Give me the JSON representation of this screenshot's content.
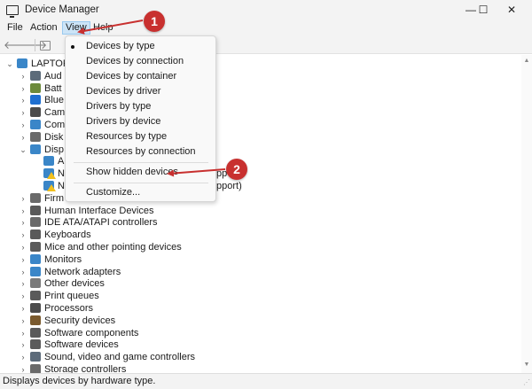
{
  "window": {
    "title": "Device Manager",
    "controls": {
      "minimize": "—",
      "maximize": "☐",
      "close": "✕"
    }
  },
  "menubar": [
    "File",
    "Action",
    "View",
    "Help"
  ],
  "toolbar": {
    "icons": [
      "back-arrow-icon",
      "forward-arrow-icon",
      "properties-icon"
    ]
  },
  "tree": {
    "root": "LAPTOP",
    "categories": [
      {
        "label": "Audio inputs and outputs",
        "visible": "Aud",
        "icon": "speaker-icon",
        "color": "#5c6b7a"
      },
      {
        "label": "Batteries",
        "visible": "Batt",
        "icon": "battery-icon",
        "color": "#6c8a3b"
      },
      {
        "label": "Bluetooth",
        "visible": "Blue",
        "icon": "bluetooth-icon",
        "color": "#1e6fd0"
      },
      {
        "label": "Cameras",
        "visible": "Cam",
        "icon": "camera-icon",
        "color": "#4b4b4b"
      },
      {
        "label": "Computer",
        "visible": "Com",
        "icon": "computer-icon",
        "color": "#3a86c8"
      },
      {
        "label": "Disk drives",
        "visible": "Disk",
        "icon": "disk-icon",
        "color": "#6a6a6a"
      },
      {
        "label": "Display adapters",
        "visible": "Disp",
        "icon": "display-icon",
        "color": "#3a86c8",
        "expanded": true
      }
    ],
    "display_children": [
      {
        "visible": "A",
        "icon": "monitor-icon",
        "warning": false
      },
      {
        "visible": "N",
        "icon": "monitor-warning-icon",
        "warning": true,
        "trailing": "pp"
      },
      {
        "visible": "N",
        "icon": "monitor-warning-icon",
        "warning": true,
        "trailing": "pport)"
      }
    ],
    "more_categories": [
      {
        "label": "Firmware",
        "visible": "Firm",
        "icon": "firmware-icon",
        "color": "#6a6a6a"
      },
      {
        "label": "Human Interface Devices",
        "icon": "hid-icon",
        "color": "#5a5a5a"
      },
      {
        "label": "IDE ATA/ATAPI controllers",
        "icon": "ide-icon",
        "color": "#6a6a6a"
      },
      {
        "label": "Keyboards",
        "icon": "keyboard-icon",
        "color": "#5a5a5a"
      },
      {
        "label": "Mice and other pointing devices",
        "icon": "mouse-icon",
        "color": "#5a5a5a"
      },
      {
        "label": "Monitors",
        "icon": "monitor-icon",
        "color": "#3a86c8"
      },
      {
        "label": "Network adapters",
        "icon": "network-icon",
        "color": "#3a86c8"
      },
      {
        "label": "Other devices",
        "icon": "other-devices-icon",
        "color": "#7a7a7a"
      },
      {
        "label": "Print queues",
        "icon": "printer-icon",
        "color": "#5a5a5a"
      },
      {
        "label": "Processors",
        "icon": "processor-icon",
        "color": "#4b4b4b"
      },
      {
        "label": "Security devices",
        "icon": "security-icon",
        "color": "#7a5a2e"
      },
      {
        "label": "Software components",
        "icon": "software-component-icon",
        "color": "#5a5a5a"
      },
      {
        "label": "Software devices",
        "icon": "software-device-icon",
        "color": "#5a5a5a"
      },
      {
        "label": "Sound, video and game controllers",
        "icon": "sound-icon",
        "color": "#5c6b7a"
      },
      {
        "label": "Storage controllers",
        "icon": "storage-icon",
        "color": "#6a6a6a"
      }
    ]
  },
  "view_menu": {
    "items": [
      {
        "label": "Devices by type",
        "checked": true
      },
      {
        "label": "Devices by connection",
        "checked": false
      },
      {
        "label": "Devices by container",
        "checked": false
      },
      {
        "label": "Devices by driver",
        "checked": false
      },
      {
        "label": "Drivers by type",
        "checked": false
      },
      {
        "label": "Drivers by device",
        "checked": false
      },
      {
        "label": "Resources by type",
        "checked": false
      },
      {
        "label": "Resources by connection",
        "checked": false
      }
    ],
    "show_hidden": "Show hidden devices",
    "customize": "Customize..."
  },
  "statusbar": {
    "text": "Displays devices by hardware type."
  },
  "annotations": [
    {
      "number": "1",
      "color": "#c8302f"
    },
    {
      "number": "2",
      "color": "#c8302f"
    }
  ]
}
